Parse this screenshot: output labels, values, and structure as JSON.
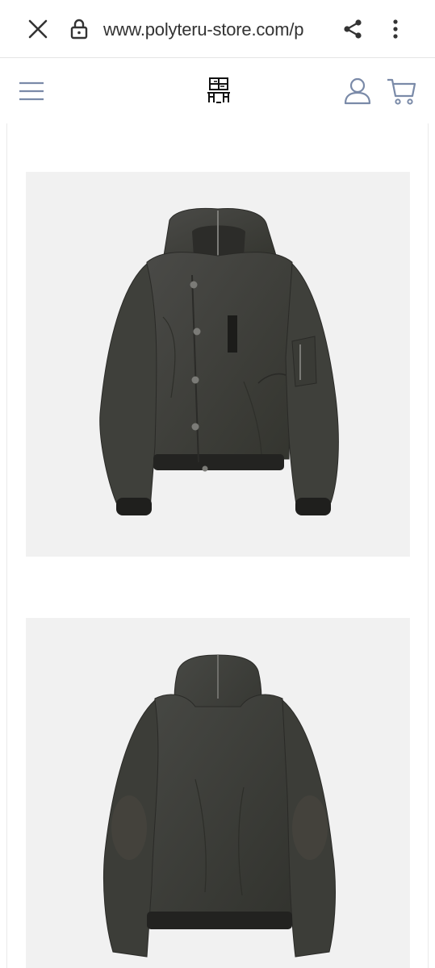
{
  "browser": {
    "url": "www.polyteru-store.com/p",
    "icons": {
      "close": "close-icon",
      "lock": "lock-icon",
      "share": "share-icon",
      "menu": "more-vert-icon"
    }
  },
  "header": {
    "icons": {
      "menu": "hamburger-icon",
      "logo": "brand-logo",
      "account": "user-icon",
      "cart": "cart-icon"
    },
    "accent_color": "#7a8aa8"
  },
  "gallery": {
    "images": [
      {
        "description_id": "front-view"
      },
      {
        "description_id": "back-view"
      }
    ]
  }
}
